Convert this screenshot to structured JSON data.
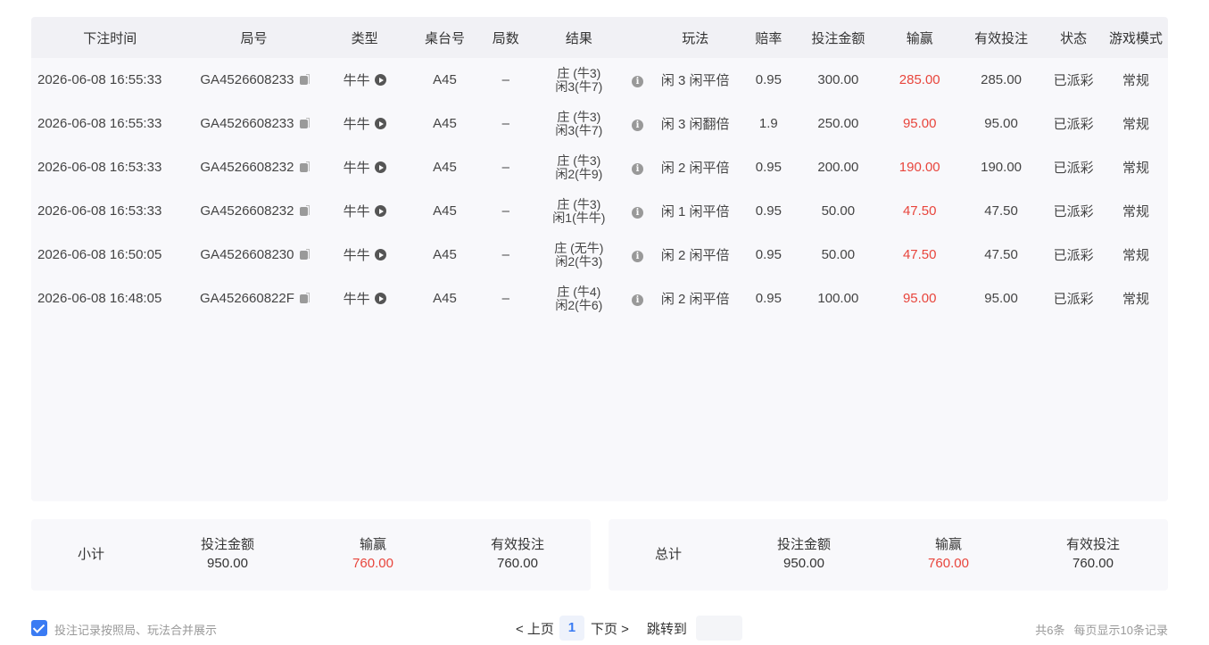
{
  "table": {
    "headers": [
      "下注时间",
      "局号",
      "类型",
      "桌台号",
      "局数",
      "结果",
      "",
      "玩法",
      "赔率",
      "投注金额",
      "输赢",
      "有效投注",
      "状态",
      "游戏模式"
    ],
    "rows": [
      {
        "time": "2026-06-08 16:55:33",
        "round": "GA4526608233",
        "type": "牛牛",
        "table": "A45",
        "count": "–",
        "result1": "庄 (牛3)",
        "result2": "闲3(牛7)",
        "play": "闲 3 闲平倍",
        "odds": "0.95",
        "bet": "300.00",
        "win": "285.00",
        "valid": "285.00",
        "status": "已派彩",
        "mode": "常规"
      },
      {
        "time": "2026-06-08 16:55:33",
        "round": "GA4526608233",
        "type": "牛牛",
        "table": "A45",
        "count": "–",
        "result1": "庄 (牛3)",
        "result2": "闲3(牛7)",
        "play": "闲 3 闲翻倍",
        "odds": "1.9",
        "bet": "250.00",
        "win": "95.00",
        "valid": "95.00",
        "status": "已派彩",
        "mode": "常规"
      },
      {
        "time": "2026-06-08 16:53:33",
        "round": "GA4526608232",
        "type": "牛牛",
        "table": "A45",
        "count": "–",
        "result1": "庄 (牛3)",
        "result2": "闲2(牛9)",
        "play": "闲 2 闲平倍",
        "odds": "0.95",
        "bet": "200.00",
        "win": "190.00",
        "valid": "190.00",
        "status": "已派彩",
        "mode": "常规"
      },
      {
        "time": "2026-06-08 16:53:33",
        "round": "GA4526608232",
        "type": "牛牛",
        "table": "A45",
        "count": "–",
        "result1": "庄 (牛3)",
        "result2": "闲1(牛牛)",
        "play": "闲 1 闲平倍",
        "odds": "0.95",
        "bet": "50.00",
        "win": "47.50",
        "valid": "47.50",
        "status": "已派彩",
        "mode": "常规"
      },
      {
        "time": "2026-06-08 16:50:05",
        "round": "GA4526608230",
        "type": "牛牛",
        "table": "A45",
        "count": "–",
        "result1": "庄 (无牛)",
        "result2": "闲2(牛3)",
        "play": "闲 2 闲平倍",
        "odds": "0.95",
        "bet": "50.00",
        "win": "47.50",
        "valid": "47.50",
        "status": "已派彩",
        "mode": "常规"
      },
      {
        "time": "2026-06-08 16:48:05",
        "round": "GA452660822F",
        "type": "牛牛",
        "table": "A45",
        "count": "–",
        "result1": "庄 (牛4)",
        "result2": "闲2(牛6)",
        "play": "闲 2 闲平倍",
        "odds": "0.95",
        "bet": "100.00",
        "win": "95.00",
        "valid": "95.00",
        "status": "已派彩",
        "mode": "常规"
      }
    ]
  },
  "subtotal": {
    "label": "小计",
    "bet_label": "投注金额",
    "bet": "950.00",
    "win_label": "输赢",
    "win": "760.00",
    "valid_label": "有效投注",
    "valid": "760.00"
  },
  "total": {
    "label": "总计",
    "bet_label": "投注金额",
    "bet": "950.00",
    "win_label": "输赢",
    "win": "760.00",
    "valid_label": "有效投注",
    "valid": "760.00"
  },
  "footer": {
    "merge_label": "投注记录按照局、玩法合并展示",
    "prev": "< 上页",
    "page": "1",
    "next": "下页 >",
    "jump": "跳转到",
    "count": "共6条",
    "per_page": "每页显示10条记录"
  },
  "colors": {
    "accent": "#3a7bf3",
    "win": "#e8453c"
  }
}
